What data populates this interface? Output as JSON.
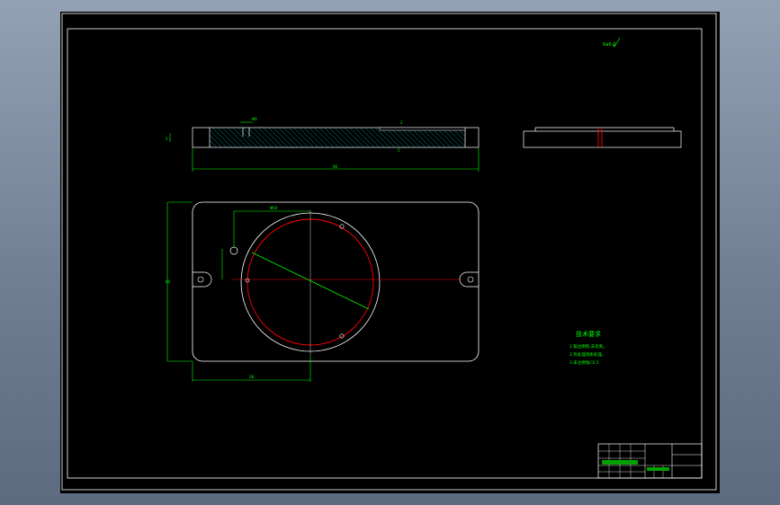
{
  "viewport": {
    "background": "#000000",
    "window_background": "#8792a8"
  },
  "colors": {
    "frame": "#ffffff",
    "dimension": "#00ff00",
    "circle": "#ff0000",
    "hatch": "#00a0a0",
    "section_mark": "#ff0000"
  },
  "roughness_symbol": "Ra6.3",
  "dimensions": {
    "top_view_width": "Φ6",
    "overall_length": "90",
    "bore": "Φ64",
    "plate_height": "60",
    "offset": "28",
    "side_thickness": "5",
    "groove": "2"
  },
  "tech_req": {
    "title": "技术要求",
    "lines": [
      "1.锐边倒钝,去毛刺。",
      "2.热处理调质处理。",
      "3.未注倒角C0.5"
    ]
  },
  "title_block": {
    "icon": "title-block-grid"
  }
}
